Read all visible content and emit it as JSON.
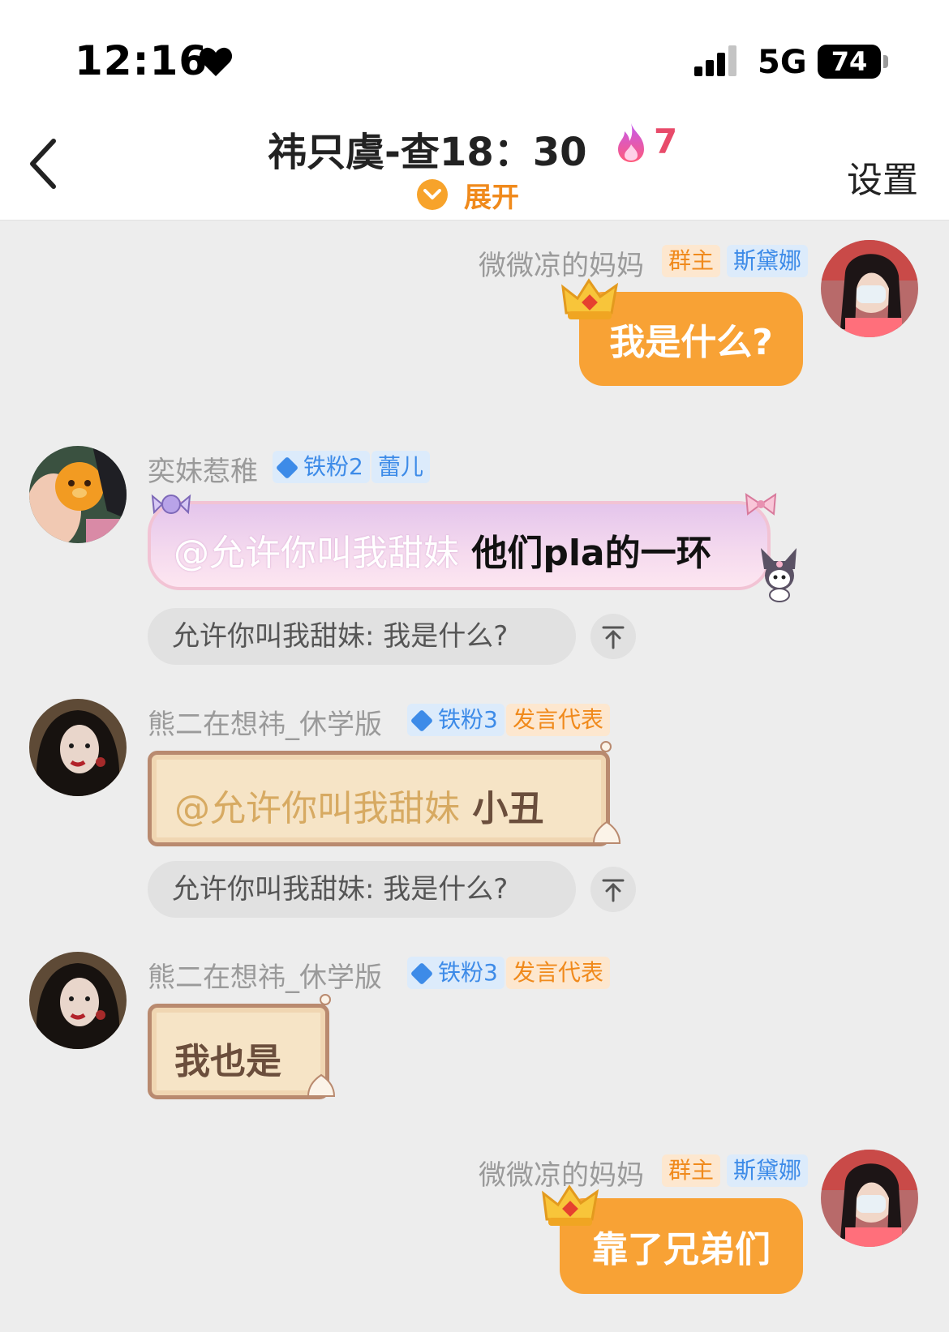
{
  "status_bar": {
    "time": "12:16",
    "network": "5G",
    "battery": "74",
    "icons": [
      "heart-icon",
      "signal-icon",
      "battery-icon"
    ]
  },
  "header": {
    "title": "祎只虞-查18：30",
    "fire_count": "7",
    "expand_label": "展开",
    "settings_label": "设置",
    "icons": [
      "back-icon",
      "fire-icon",
      "chevron-down-icon"
    ]
  },
  "messages": [
    {
      "sender": "微微凉的妈妈",
      "badges": [
        "群主",
        "斯黛娜"
      ],
      "text": "我是什么?",
      "mine": true
    },
    {
      "sender": "奕妹惹稚",
      "badges": [
        "铁粉2",
        "蕾儿"
      ],
      "mention": "@允许你叫我甜妹",
      "text": " 他们pla的一环",
      "quote": "允许你叫我甜妹: 我是什么?"
    },
    {
      "sender": "熊二在想祎_休学版",
      "badges": [
        "铁粉3",
        "发言代表"
      ],
      "mention": "@允许你叫我甜妹",
      "text": " 小丑",
      "quote": "允许你叫我甜妹: 我是什么?"
    },
    {
      "sender": "熊二在想祎_休学版",
      "badges": [
        "铁粉3",
        "发言代表"
      ],
      "text": "我也是"
    },
    {
      "sender": "微微凉的妈妈",
      "badges": [
        "群主",
        "斯黛娜"
      ],
      "text": "靠了兄弟们",
      "mine": true
    }
  ],
  "colors": {
    "accent_orange": "#f8a235",
    "badge_blue": "#3d8be8",
    "fire_pink": "#e84b6a",
    "background": "#ededed"
  }
}
